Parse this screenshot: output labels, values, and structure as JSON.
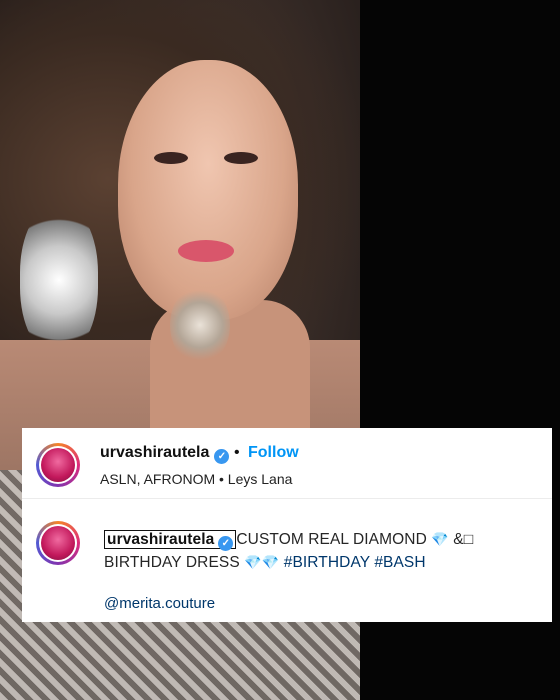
{
  "post": {
    "username": "urvashirautela",
    "follow_label": "Follow",
    "dot": "•",
    "subtitle": "ASLN, AFRONOM • Leys Lana",
    "caption": {
      "username": "urvashirautela",
      "text_part1": "CUSTOM REAL DIAMOND",
      "text_part2": "&□ BIRTHDAY DRESS",
      "gem": "💎",
      "hashtag1": "#BIRTHDAY",
      "hashtag2": "#BASH",
      "mention": "@merita.couture"
    },
    "verified_icon": "verified-badge-icon",
    "colors": {
      "follow": "#0095f6",
      "verified": "#3897f0",
      "link": "#00376b"
    }
  }
}
